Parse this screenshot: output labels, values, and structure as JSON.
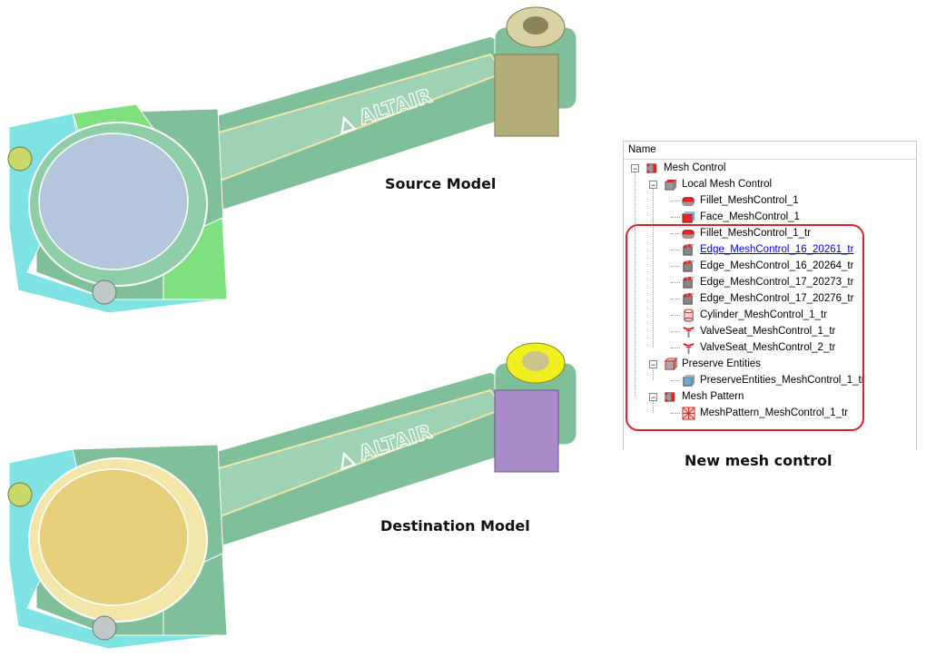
{
  "captions": {
    "source": "Source Model",
    "destination": "Destination Model",
    "new_control": "New mesh control"
  },
  "model_logo": "ALTAIR",
  "colors": {
    "rod_green": "#7fbf9a",
    "cyan": "#7fe3e3",
    "light_green": "#7fe07f",
    "source_bore": "#b4c6dc",
    "dest_bore": "#e6cf7a",
    "fillet_yellow": "#f2e6a8",
    "pin_olive": "#b3ad7a",
    "pin_purple": "#a98bc9",
    "highlight_red": "#e0202a"
  },
  "tree": {
    "header": "Name",
    "items": [
      {
        "label": "Mesh Control",
        "icon": "mesh-control-icon",
        "level": 0,
        "expanded": true
      },
      {
        "label": "Local Mesh Control",
        "icon": "local-mesh-control-icon",
        "level": 1,
        "expanded": true
      },
      {
        "label": "Fillet_MeshControl_1",
        "icon": "fillet-icon",
        "level": 2
      },
      {
        "label": "Face_MeshControl_1",
        "icon": "face-icon",
        "level": 2
      },
      {
        "label": "Fillet_MeshControl_1_tr",
        "icon": "fillet-icon",
        "level": 2
      },
      {
        "label": "Edge_MeshControl_16_20261_tr",
        "icon": "edge-icon",
        "level": 2,
        "selected": true
      },
      {
        "label": "Edge_MeshControl_16_20264_tr",
        "icon": "edge-icon",
        "level": 2
      },
      {
        "label": "Edge_MeshControl_17_20273_tr",
        "icon": "edge-icon",
        "level": 2
      },
      {
        "label": "Edge_MeshControl_17_20276_tr",
        "icon": "edge-icon",
        "level": 2
      },
      {
        "label": "Cylinder_MeshControl_1_tr",
        "icon": "cylinder-icon",
        "level": 2
      },
      {
        "label": "ValveSeat_MeshControl_1_tr",
        "icon": "valve-seat-icon",
        "level": 2
      },
      {
        "label": "ValveSeat_MeshControl_2_tr",
        "icon": "valve-seat-icon",
        "level": 2
      },
      {
        "label": "Preserve Entities",
        "icon": "preserve-entities-icon",
        "level": 1,
        "expanded": true
      },
      {
        "label": "PreserveEntities_MeshControl_1_tr",
        "icon": "preserve-icon",
        "level": 2
      },
      {
        "label": "Mesh Pattern",
        "icon": "mesh-pattern-group-icon",
        "level": 1,
        "expanded": true
      },
      {
        "label": "MeshPattern_MeshControl_1_tr",
        "icon": "mesh-pattern-icon",
        "level": 2
      }
    ]
  }
}
